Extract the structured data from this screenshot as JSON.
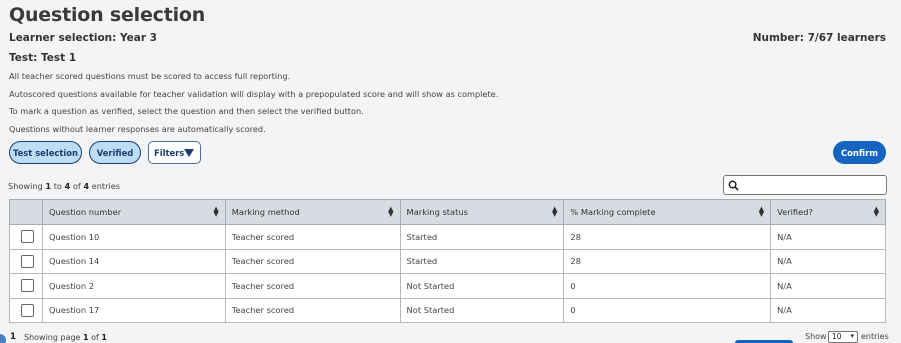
{
  "page": {
    "title": "Question selection",
    "learner_selection": "Learner selection:  Year 3",
    "number": "Number: 7/67 learners",
    "test": "Test: Test 1",
    "info_lines": [
      "All teacher scored questions must be scored to access full reporting.",
      "Autoscored questions available for teacher validation will display with a prepopulated score and will show as complete.",
      "To mark a question as verified, select the question and then select the verified button.",
      "Questions without learner responses are automatically scored."
    ]
  },
  "toolbar": {
    "test_selection_label": "Test selection",
    "verified_label": "Verified",
    "filters_label": "Filters",
    "confirm_label": "Confirm"
  },
  "listing": {
    "showing_prefix": "Showing",
    "from": "1",
    "to_word": "to",
    "to": "4",
    "of_word": "of",
    "total": "4",
    "suffix": "entries"
  },
  "table": {
    "headers": [
      "Question number",
      "Marking method",
      "Marking status",
      "% Marking complete",
      "Verified?"
    ],
    "rows": [
      [
        "Question 10",
        "Teacher scored",
        "Started",
        "28",
        "N/A"
      ],
      [
        "Question 14",
        "Teacher scored",
        "Started",
        "28",
        "N/A"
      ],
      [
        "Question 2",
        "Teacher scored",
        "Not Started",
        "0",
        "N/A"
      ],
      [
        "Question 17",
        "Teacher scored",
        "Not Started",
        "0",
        "N/A"
      ]
    ]
  },
  "pagination": {
    "current": "1",
    "showing_page": "Showing page",
    "page": "1",
    "of_word": "of",
    "pages": "1",
    "show_label": "Show",
    "page_size": "10",
    "entries_label": "entries"
  },
  "colors": {
    "accent": "#1565c0",
    "pill_bg": "#bfdcf7",
    "header_bg": "#d9dbe2"
  },
  "icons": {
    "search": "search-icon",
    "filter": "triangle-down-icon",
    "sort": "sort-icon"
  }
}
